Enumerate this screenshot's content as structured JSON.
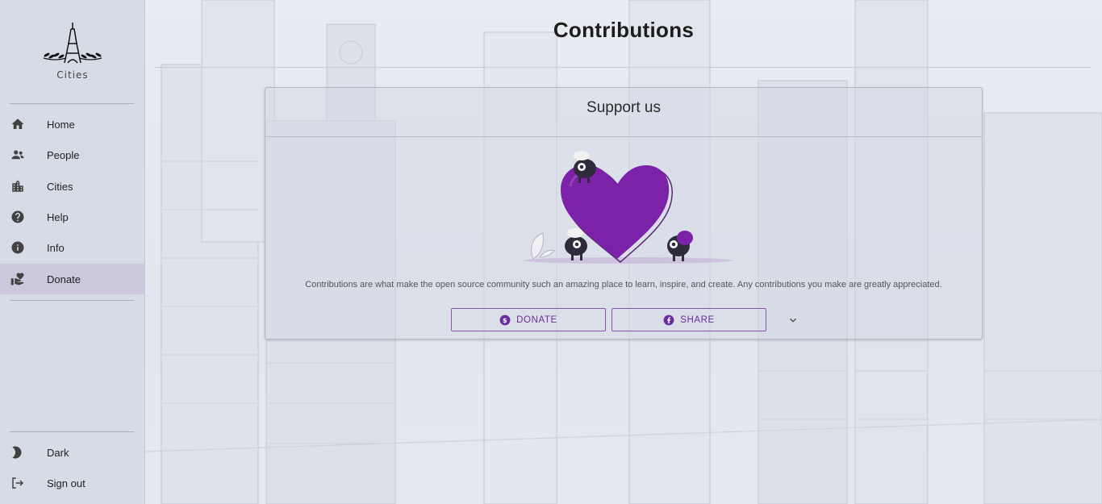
{
  "sidebar": {
    "logo_text": "Cities",
    "nav": [
      {
        "label": "Home",
        "icon": "home-icon"
      },
      {
        "label": "People",
        "icon": "people-icon"
      },
      {
        "label": "Cities",
        "icon": "city-icon"
      },
      {
        "label": "Help",
        "icon": "help-icon"
      },
      {
        "label": "Info",
        "icon": "info-icon"
      },
      {
        "label": "Donate",
        "icon": "donate-icon",
        "active": true
      }
    ],
    "bottom": [
      {
        "label": "Dark",
        "icon": "moon-icon"
      },
      {
        "label": "Sign out",
        "icon": "sign-out-icon"
      }
    ]
  },
  "main": {
    "title": "Contributions",
    "card": {
      "title": "Support us",
      "text": "Contributions are what make the open source community such an amazing place to learn, inspire, and create. Any contributions you make are greatly appreciated.",
      "donate_label": "Donate",
      "share_label": "Share"
    }
  },
  "colors": {
    "accent": "#6a2d9e",
    "heart": "#7b22a8",
    "sidebar_bg": "#d5dce6",
    "active_bg": "#cdc8de"
  }
}
